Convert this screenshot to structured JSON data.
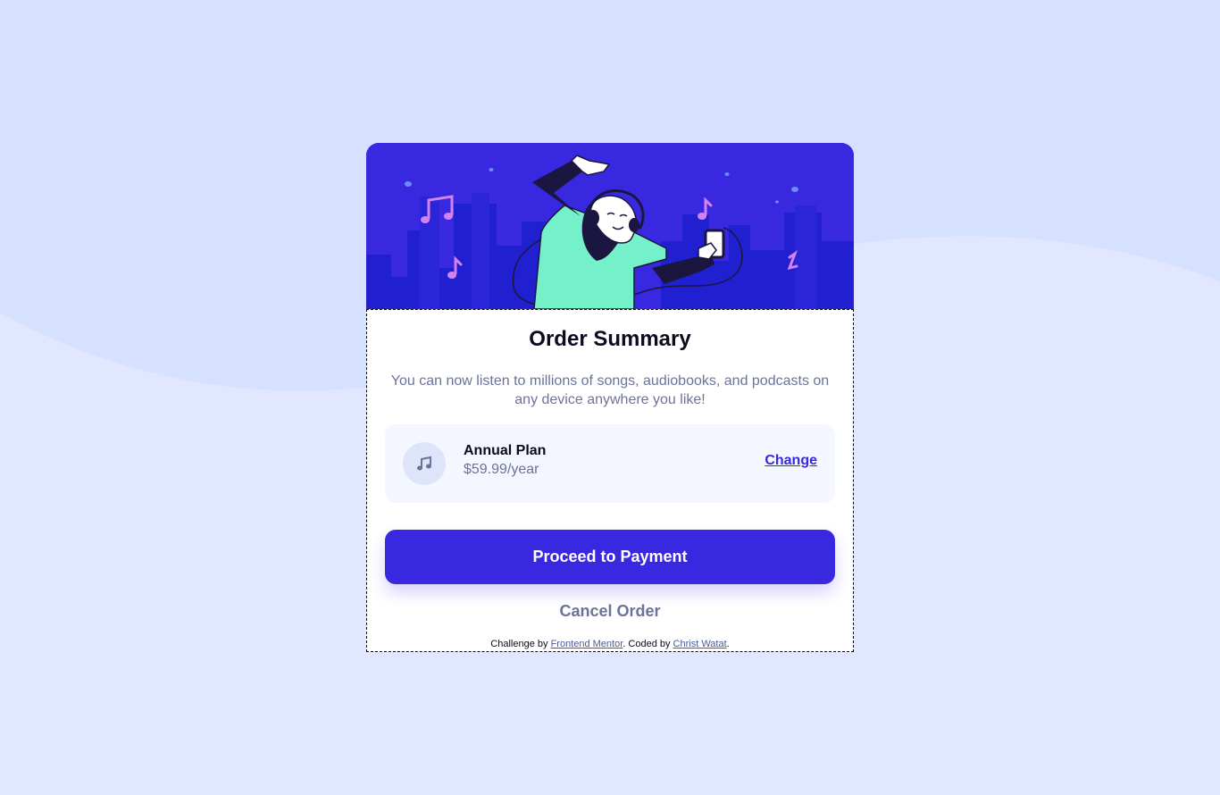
{
  "colors": {
    "page_background": "#e0e7ff",
    "wave": "#d6e0ff",
    "primary": "#3829e0",
    "desaturated_blue": "#6b7399",
    "plan_background": "#f4f7ff",
    "white": "#ffffff"
  },
  "hero": {
    "illustration": "person-dancing-with-headphones-and-music-notes-over-city-skyline"
  },
  "order": {
    "title": "Order Summary",
    "description": "You can now listen to millions of songs, audiobooks, and podcasts on any device anywhere you like!"
  },
  "plan": {
    "icon": "music-note-icon",
    "name": "Annual Plan",
    "price": "$59.99/year",
    "change_label": "Change"
  },
  "actions": {
    "proceed_label": "Proceed to Payment",
    "cancel_label": "Cancel Order"
  },
  "attribution": {
    "prefix": "Challenge by ",
    "challenge_link": "Frontend Mentor",
    "middle": ". Coded by ",
    "author_link": "Christ Watat",
    "suffix": "."
  }
}
